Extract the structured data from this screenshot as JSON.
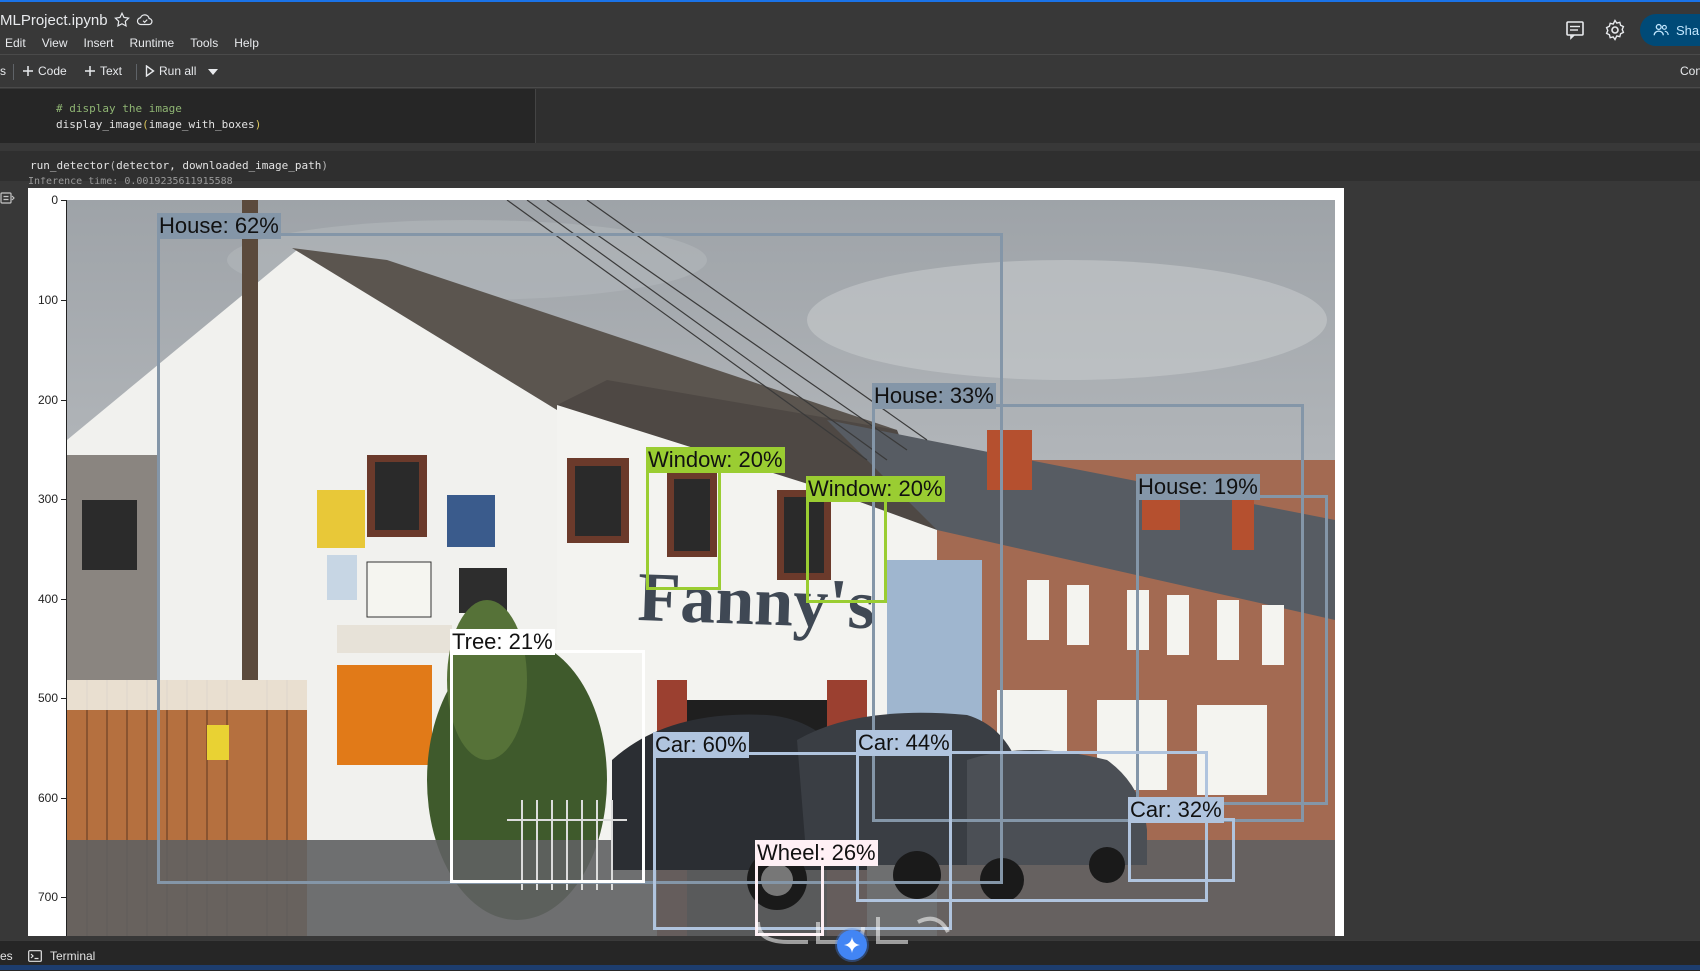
{
  "app": {
    "notebook_title": "MLProject.ipynb",
    "share_label": "Sha"
  },
  "menu": [
    "Edit",
    "View",
    "Insert",
    "Runtime",
    "Tools",
    "Help"
  ],
  "toolbar": {
    "left_fragment": "s",
    "code_label": "Code",
    "text_label": "Text",
    "run_all_label": "Run all",
    "right_fragment": "Con"
  },
  "cells": [
    {
      "comment": "# display the image",
      "code_fn": "display_image",
      "code_arg": "image_with_boxes"
    },
    {
      "code_fn": "run_detector",
      "code_args": "detector, downloaded_image_path",
      "output_partial": "Inference time:  0.0019235611915588"
    }
  ],
  "figure": {
    "y_ticks": [
      "0",
      "100",
      "200",
      "300",
      "400",
      "500",
      "600",
      "700"
    ],
    "detections": [
      {
        "label": "House: 62%",
        "color": "#8496a8"
      },
      {
        "label": "House: 33%",
        "color": "#8496a8"
      },
      {
        "label": "House: 19%",
        "color": "#8496a8"
      },
      {
        "label": "Window: 20%",
        "color": "#9acd32"
      },
      {
        "label": "Window: 20%",
        "color": "#9acd32"
      },
      {
        "label": "Tree: 21%",
        "color": "#ffffff"
      },
      {
        "label": "Car: 60%",
        "color": "#b0c4de"
      },
      {
        "label": "Car: 44%",
        "color": "#b0c4de"
      },
      {
        "label": "Car: 32%",
        "color": "#b0c4de"
      },
      {
        "label": "Wheel: 26%",
        "color": "#fff0f5"
      }
    ]
  },
  "bottom": {
    "left_fragment": "es",
    "terminal_label": "Terminal"
  },
  "colors": {
    "accent": "#1a73e8",
    "bg": "#383838",
    "share_bg": "#004a77"
  }
}
